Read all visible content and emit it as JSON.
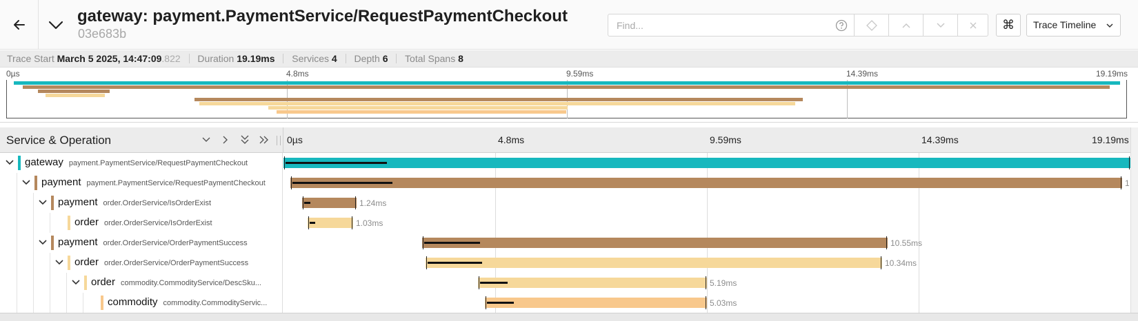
{
  "header": {
    "title": "gateway: payment.PaymentService/RequestPaymentCheckout",
    "trace_id": "03e683b",
    "find_placeholder": "Find...",
    "keyboard_symbol": "⌘",
    "view_select": "Trace Timeline"
  },
  "summary": {
    "trace_start_label": "Trace Start",
    "trace_start_value": "March 5 2025, 14:47:09",
    "trace_start_ms": ".822",
    "duration_label": "Duration",
    "duration_value": "19.19ms",
    "services_label": "Services",
    "services_value": "4",
    "depth_label": "Depth",
    "depth_value": "6",
    "total_spans_label": "Total Spans",
    "total_spans_value": "8"
  },
  "ticks": [
    "0µs",
    "4.8ms",
    "9.59ms",
    "14.39ms",
    "19.19ms"
  ],
  "column_title": "Service & Operation",
  "colors": {
    "gateway": "#17b8be",
    "payment": "#b5885d",
    "order": "#f6d89a",
    "commodity": "#f8c88c"
  },
  "spans": [
    {
      "service": "gateway",
      "operation": "payment.PaymentService/RequestPaymentCheckout",
      "depth": 0,
      "collapsible": true,
      "start_ms": 0.0,
      "duration_ms": 19.19,
      "label": ""
    },
    {
      "service": "payment",
      "operation": "payment.PaymentService/RequestPaymentCheckout",
      "depth": 1,
      "collapsible": true,
      "start_ms": 0.15,
      "duration_ms": 18.85,
      "label": "1"
    },
    {
      "service": "payment",
      "operation": "order.OrderService/IsOrderExist",
      "depth": 2,
      "collapsible": true,
      "start_ms": 0.42,
      "duration_ms": 1.24,
      "label": "1.24ms"
    },
    {
      "service": "order",
      "operation": "order.OrderService/IsOrderExist",
      "depth": 3,
      "collapsible": false,
      "start_ms": 0.55,
      "duration_ms": 1.03,
      "label": "1.03ms"
    },
    {
      "service": "payment",
      "operation": "order.OrderService/OrderPaymentSuccess",
      "depth": 2,
      "collapsible": true,
      "start_ms": 3.14,
      "duration_ms": 10.55,
      "label": "10.55ms"
    },
    {
      "service": "order",
      "operation": "order.OrderService/OrderPaymentSuccess",
      "depth": 3,
      "collapsible": true,
      "start_ms": 3.22,
      "duration_ms": 10.34,
      "label": "10.34ms"
    },
    {
      "service": "order",
      "operation": "commodity.CommodityService/DescSku...",
      "depth": 4,
      "collapsible": true,
      "start_ms": 4.41,
      "duration_ms": 5.19,
      "label": "5.19ms"
    },
    {
      "service": "commodity",
      "operation": "commodity.CommodityServic...",
      "depth": 5,
      "collapsible": false,
      "start_ms": 4.56,
      "duration_ms": 5.03,
      "label": "5.03ms"
    }
  ]
}
